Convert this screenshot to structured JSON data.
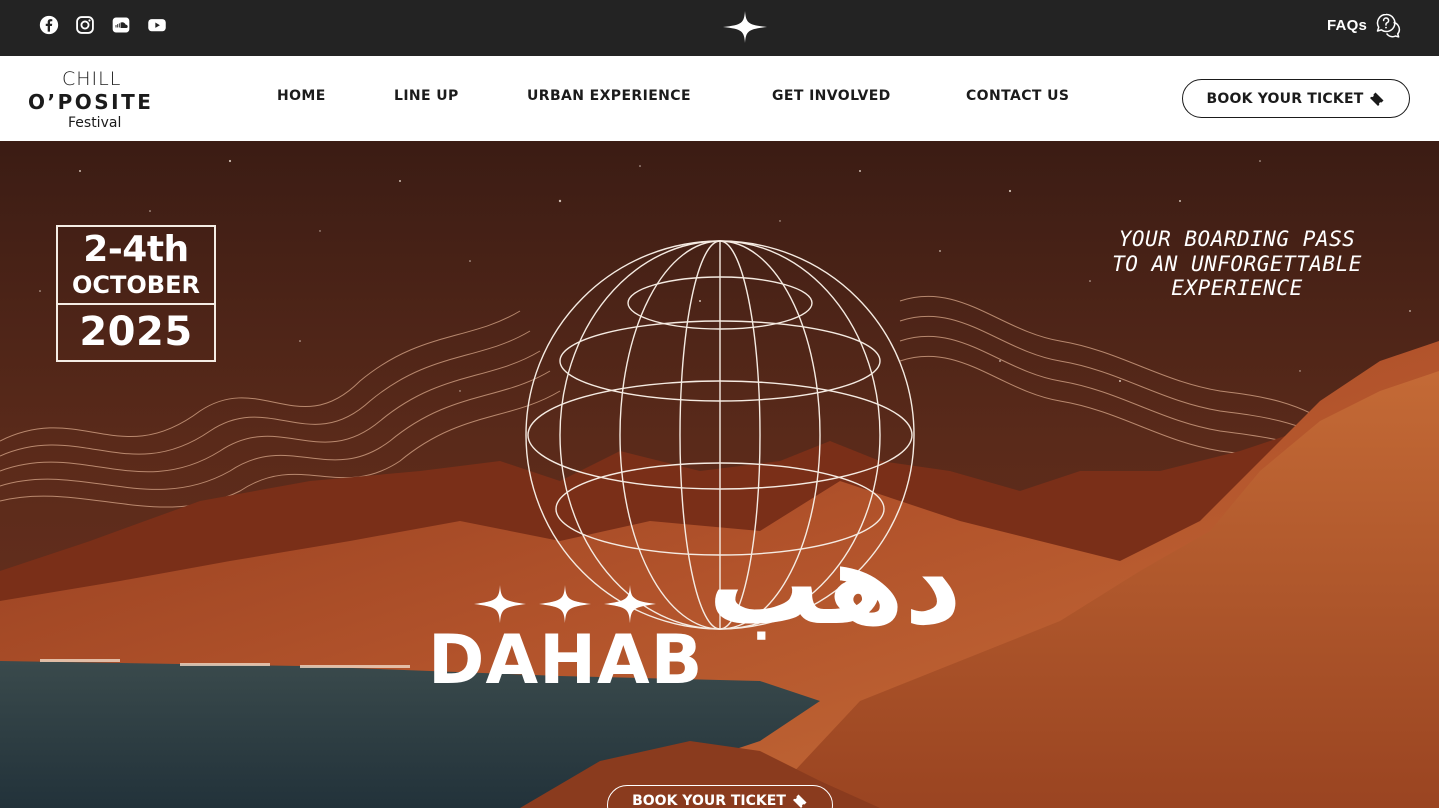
{
  "topbar": {
    "socials": [
      {
        "icon": "facebook-icon"
      },
      {
        "icon": "instagram-icon"
      },
      {
        "icon": "soundcloud-icon"
      },
      {
        "icon": "youtube-icon"
      }
    ],
    "center_icon": "sparkle-star-icon",
    "faqs_label": "FAQs"
  },
  "logo": {
    "line1": "CHILL",
    "line2": "O’POSITE",
    "line3": "Festival"
  },
  "nav": {
    "items": [
      {
        "label": "HOME"
      },
      {
        "label": "LINE UP"
      },
      {
        "label": "URBAN EXPERIENCE"
      },
      {
        "label": "GET INVOLVED"
      },
      {
        "label": "CONTACT US"
      }
    ],
    "book_label": "BOOK YOUR TICKET"
  },
  "hero": {
    "date_days": "2-4th",
    "date_month": "OCTOBER",
    "date_year": "2025",
    "tagline_lines": [
      "YOUR BOARDING PASS",
      "TO AN UNFORGETTABLE",
      "EXPERIENCE"
    ],
    "title": "DAHAB",
    "title_arabic": "دهب",
    "cta_label": "BOOK YOUR TICKET"
  },
  "colors": {
    "topbar": "#232323",
    "navbar": "#ffffff",
    "text_dark": "#1b1b1b",
    "hero_sky": "#3a1a12",
    "hero_mountain": "#b4522b",
    "sea": "#2c3e44"
  }
}
